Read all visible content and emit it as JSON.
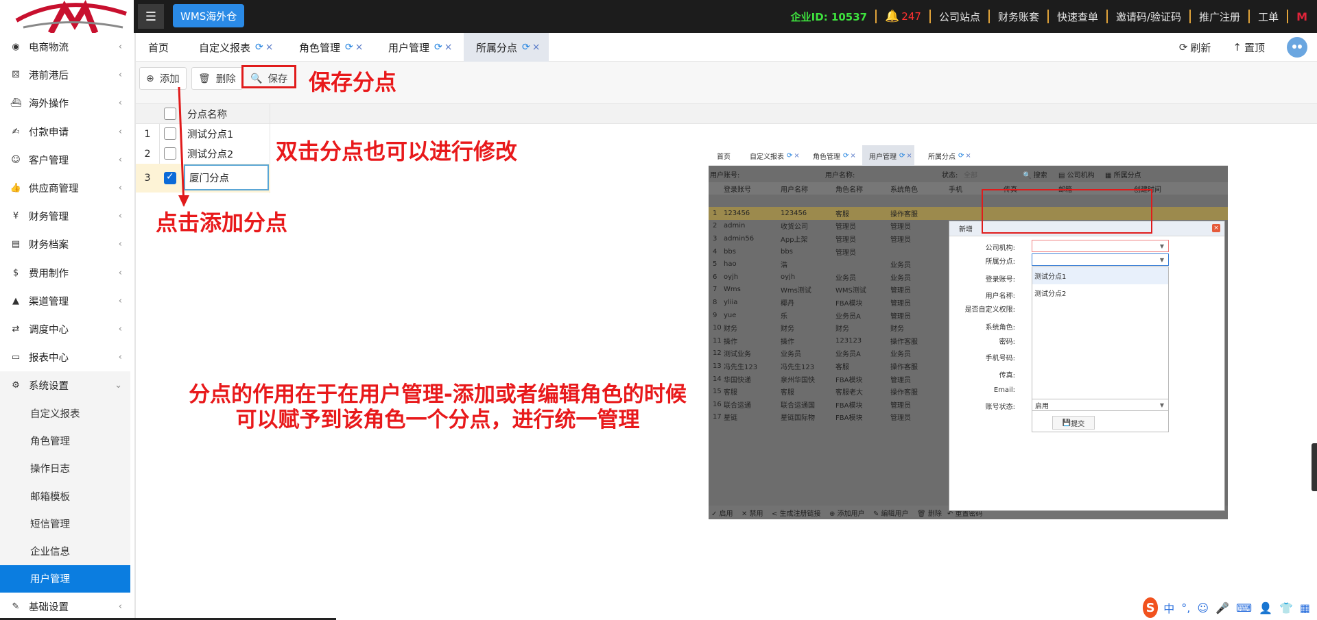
{
  "header": {
    "brand": "WMS海外仓",
    "corp_id": "企业ID: 10537",
    "notif_count": "247",
    "links": [
      "公司站点",
      "财务账套",
      "快速查单",
      "邀请码/验证码",
      "推广注册",
      "工单"
    ]
  },
  "sidebar": {
    "items": [
      {
        "label": "电商物流",
        "icon": "globe-icon",
        "glyph": "◉"
      },
      {
        "label": "港前港后",
        "icon": "cubes-icon",
        "glyph": "⚄"
      },
      {
        "label": "海外操作",
        "icon": "ship-icon",
        "glyph": "⛴"
      },
      {
        "label": "付款申请",
        "icon": "money-hand-icon",
        "glyph": "✍"
      },
      {
        "label": "客户管理",
        "icon": "users-icon",
        "glyph": "☺"
      },
      {
        "label": "供应商管理",
        "icon": "thumbs-up-icon",
        "glyph": "👍"
      },
      {
        "label": "财务管理",
        "icon": "yen-icon",
        "glyph": "¥"
      },
      {
        "label": "财务档案",
        "icon": "book-icon",
        "glyph": "▤"
      },
      {
        "label": "费用制作",
        "icon": "dollar-icon",
        "glyph": "$"
      },
      {
        "label": "渠道管理",
        "icon": "road-icon",
        "glyph": "▲"
      },
      {
        "label": "调度中心",
        "icon": "retweet-icon",
        "glyph": "⇄"
      },
      {
        "label": "报表中心",
        "icon": "file-text-icon",
        "glyph": "▭"
      },
      {
        "label": "系统设置",
        "icon": "gear-icon",
        "glyph": "⚙"
      }
    ],
    "sub_items": [
      "自定义报表",
      "角色管理",
      "操作日志",
      "邮箱模板",
      "短信管理",
      "企业信息",
      "用户管理"
    ],
    "last_item": {
      "label": "基础设置",
      "icon": "edit-icon",
      "glyph": "✎"
    }
  },
  "tabs": [
    {
      "label": "首页"
    },
    {
      "label": "自定义报表"
    },
    {
      "label": "角色管理"
    },
    {
      "label": "用户管理"
    },
    {
      "label": "所属分点"
    }
  ],
  "tab_actions": {
    "refresh": "刷新",
    "top": "置顶"
  },
  "toolbar": {
    "add": "添加",
    "delete": "删除",
    "save": "保存"
  },
  "grid": {
    "column": "分点名称",
    "rows": [
      {
        "num": "1",
        "name": "测试分点1",
        "checked": false
      },
      {
        "num": "2",
        "name": "测试分点2",
        "checked": false
      },
      {
        "num": "3",
        "name": "厦门分点",
        "checked": true
      }
    ]
  },
  "annotations": {
    "save": "保存分点",
    "dblclick": "双击分点也可以进行修改",
    "add": "点击添加分点",
    "purpose_line1": "分点的作用在于在用户管理-添加或者编辑角色的时候",
    "purpose_line2": "可以赋予到该角色一个分点，进行统一管理"
  },
  "embed": {
    "tabs": [
      "首页",
      "自定义报表",
      "角色管理",
      "用户管理",
      "所属分点"
    ],
    "filter": {
      "account": "用户账号:",
      "name": "用户名称:",
      "status": "状态:",
      "status_value": "全部",
      "search": "搜索",
      "org": "公司机构",
      "branch": "所属分点"
    },
    "columns": [
      "登录账号",
      "用户名称",
      "角色名称",
      "系统角色",
      "手机",
      "传真",
      "邮箱",
      "创建时间"
    ],
    "rows": [
      [
        "1",
        "123456",
        "123456",
        "客服",
        "操作客服"
      ],
      [
        "2",
        "admin",
        "收货公司",
        "管理员",
        "管理员"
      ],
      [
        "3",
        "admin56",
        "App上架",
        "管理员",
        "管理员"
      ],
      [
        "4",
        "bbs",
        "bbs",
        "管理员",
        ""
      ],
      [
        "5",
        "hao",
        "浩",
        "",
        "业务员"
      ],
      [
        "6",
        "oyjh",
        "oyjh",
        "业务员",
        "业务员"
      ],
      [
        "7",
        "Wms",
        "Wms测试",
        "WMS测试",
        "管理员"
      ],
      [
        "8",
        "yliia",
        "椰丹",
        "FBA模块",
        "管理员"
      ],
      [
        "9",
        "yue",
        "乐",
        "业务员A",
        "管理员"
      ],
      [
        "10",
        "财务",
        "财务",
        "财务",
        "财务"
      ],
      [
        "11",
        "操作",
        "操作",
        "123123",
        "操作客服"
      ],
      [
        "12",
        "测试业务",
        "业务员",
        "业务员A",
        "业务员"
      ],
      [
        "13",
        "冯先生123",
        "冯先生123",
        "客服",
        "操作客服"
      ],
      [
        "14",
        "华国快递",
        "泉州华国快",
        "FBA模块",
        "管理员"
      ],
      [
        "15",
        "客服",
        "客服",
        "客服老大",
        "操作客服"
      ],
      [
        "16",
        "联合运通",
        "联合运通国",
        "FBA模块",
        "管理员"
      ],
      [
        "17",
        "星链",
        "星链国际物",
        "FBA模块",
        "管理员"
      ]
    ],
    "footer": [
      "启用",
      "禁用",
      "生成注册链接",
      "添加用户",
      "编辑用户",
      "删除",
      "重置密码"
    ],
    "modal": {
      "title": "新增",
      "labels": [
        "公司机构:",
        "所属分点:",
        "登录账号:",
        "用户名称:",
        "是否自定义权限:",
        "系统角色:",
        "密码:",
        "手机号码:",
        "传真:",
        "Email:",
        "账号状态:"
      ],
      "options": [
        "测试分点1",
        "测试分点2"
      ],
      "status_value": "启用",
      "submit": "提交"
    }
  },
  "ime": {
    "lang": "中"
  }
}
